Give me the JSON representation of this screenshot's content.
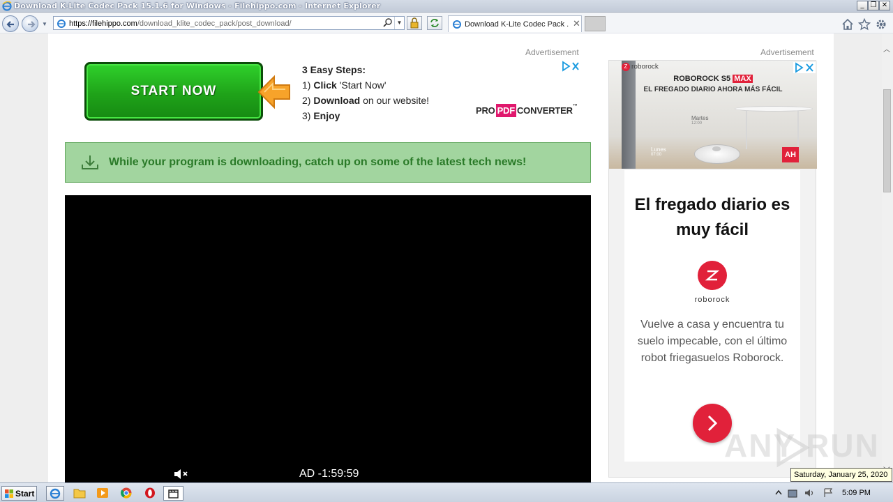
{
  "window": {
    "title": "Download K-Lite Codec Pack 15.1.6 for Windows - Filehippo.com - Internet Explorer",
    "min_symbol": "_",
    "max_symbol": "❐",
    "close_symbol": "✕"
  },
  "browser": {
    "url_host": "https://filehippo.com",
    "url_path": "/download_klite_codec_pack/post_download/",
    "tab_label": "Download K-Lite Codec Pack ...",
    "tab_close": "✕",
    "icons": [
      "back-arrow-icon",
      "forward-arrow-icon",
      "search-icon",
      "lock-icon",
      "refresh-icon",
      "home-icon",
      "star-icon",
      "gear-icon"
    ]
  },
  "page": {
    "ad_label": "Advertisement",
    "side_ad_label": "Advertisement",
    "start_now": "START NOW",
    "steps": {
      "heading": "3 Easy Steps:",
      "step1_prefix": "1) ",
      "step1_bold": "Click",
      "step1_rest": " 'Start Now'",
      "step2_prefix": "2) ",
      "step2_bold": "Download",
      "step2_rest": " on our website!",
      "step3_prefix": "3) ",
      "step3_bold": "Enjoy"
    },
    "propdf": {
      "pro": "PRO",
      "pdf": "PDF",
      "converter": "CONVERTER",
      "tm": "™"
    },
    "banner_text": "While your program is downloading, catch up on some of the latest tech news!",
    "video": {
      "ad_timer": "AD  -1:59:59"
    }
  },
  "side_ad": {
    "brand_small": "roborock",
    "brand_z": "Z",
    "title_prefix": "ROBOROCK S5 ",
    "title_max": "MAX",
    "subtitle": "EL FREGADO DIARIO AHORA MÁS FÁCIL",
    "day1": "Martes",
    "time1": "12:00",
    "day2": "Lunes",
    "time2": "07:00",
    "ah": "AH",
    "card_title": "El fregado diario es muy fácil",
    "brand_name": "roborock",
    "card_body": "Vuelve a casa y encuentra tu suelo impecable, con el último robot friegasuelos Roborock."
  },
  "watermark": "ANY  RUN",
  "taskbar": {
    "start_label": "Start",
    "clock": "5:09 PM",
    "date_tooltip": "Saturday, January 25, 2020"
  },
  "colors": {
    "banner_bg": "#a2d59f",
    "banner_text": "#2a7a28",
    "start_green": "#1fa319",
    "roborock_red": "#e1213a",
    "pdf_pink": "#e0186d"
  }
}
